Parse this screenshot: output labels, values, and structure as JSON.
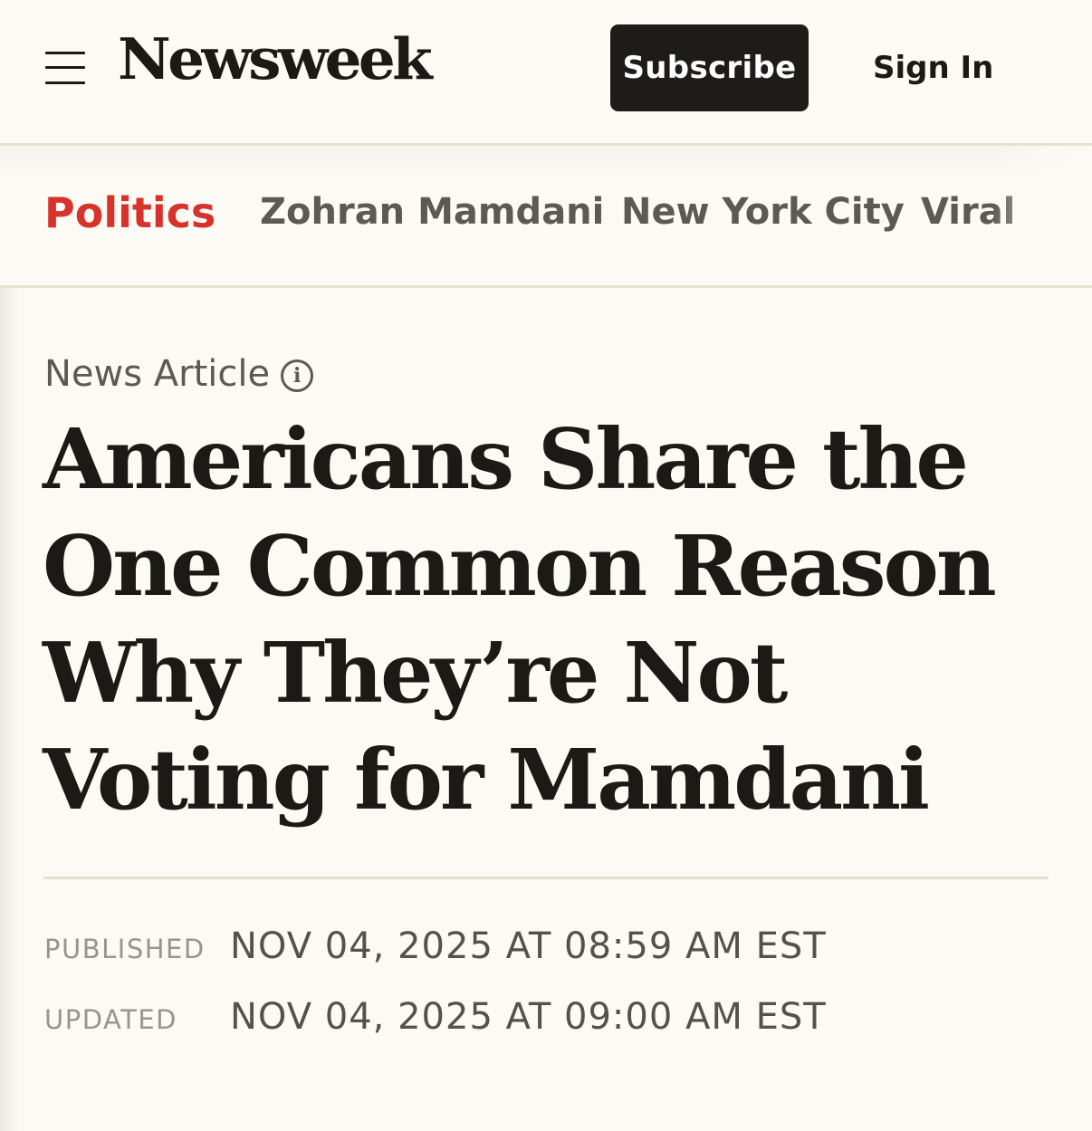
{
  "header": {
    "menu_icon": "hamburger-menu-icon",
    "logo": "Newsweek",
    "subscribe_label": "Subscribe",
    "signin_label": "Sign In"
  },
  "topics": [
    {
      "label": "Politics",
      "active": true
    },
    {
      "label": "Zohran Mamdani",
      "active": false
    },
    {
      "label": "New York City",
      "active": false
    },
    {
      "label": "Viral",
      "active": false
    }
  ],
  "article": {
    "type_label": "News Article",
    "info_icon": "info-circle-icon",
    "info_glyph": "i",
    "headline": "Americans Share the One Common Reason Why They’re Not Voting for Mamdani",
    "published_label": "PUBLISHED",
    "published_value": "NOV 04, 2025 AT 08:59 AM EST",
    "updated_label": "UPDATED",
    "updated_value": "NOV 04, 2025 AT 09:00 AM EST"
  },
  "colors": {
    "background": "#fcfaf4",
    "text": "#1b1a17",
    "accent_red": "#d7322b",
    "muted": "#5d5a52",
    "divider": "#e6e0cf"
  }
}
